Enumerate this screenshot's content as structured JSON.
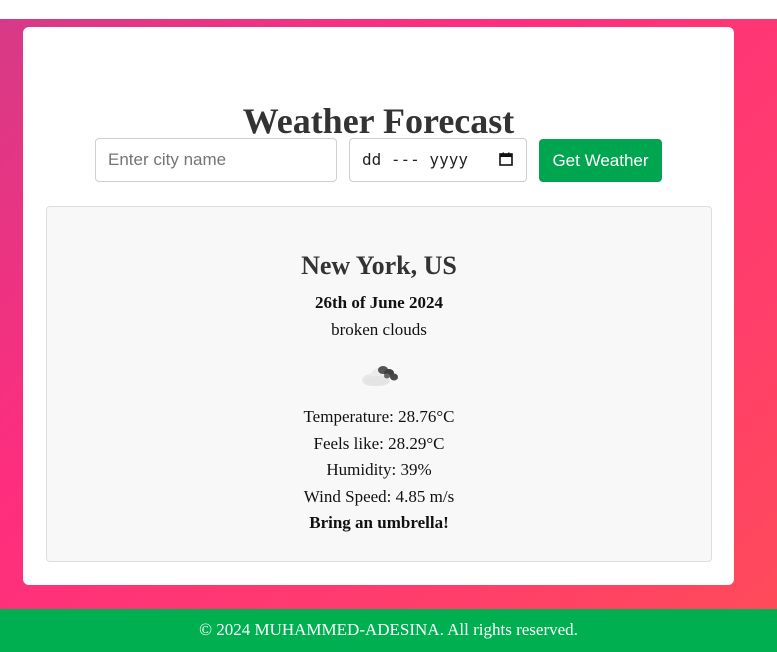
{
  "header": {
    "title": "Weather Forecast"
  },
  "search": {
    "city_placeholder": "Enter city name",
    "city_value": "",
    "date_display": "dd --- yyyy",
    "button_label": "Get Weather"
  },
  "weather": {
    "location": "New York, US",
    "date": "26th of June 2024",
    "description": "broken clouds",
    "icon": "broken-clouds-icon",
    "temperature": "Temperature: 28.76°C",
    "feels_like": "Feels like: 28.29°C",
    "humidity": "Humidity: 39%",
    "wind_speed": "Wind Speed: 4.85 m/s",
    "advice": "Bring an umbrella!"
  },
  "footer": {
    "text": "© 2024 MUHAMMED-ADESINA. All rights reserved."
  },
  "colors": {
    "accent_green": "#00a550",
    "footer_green": "#00b050",
    "background_gradient_start": "#d63a86",
    "background_gradient_end": "#ff4a5a"
  }
}
